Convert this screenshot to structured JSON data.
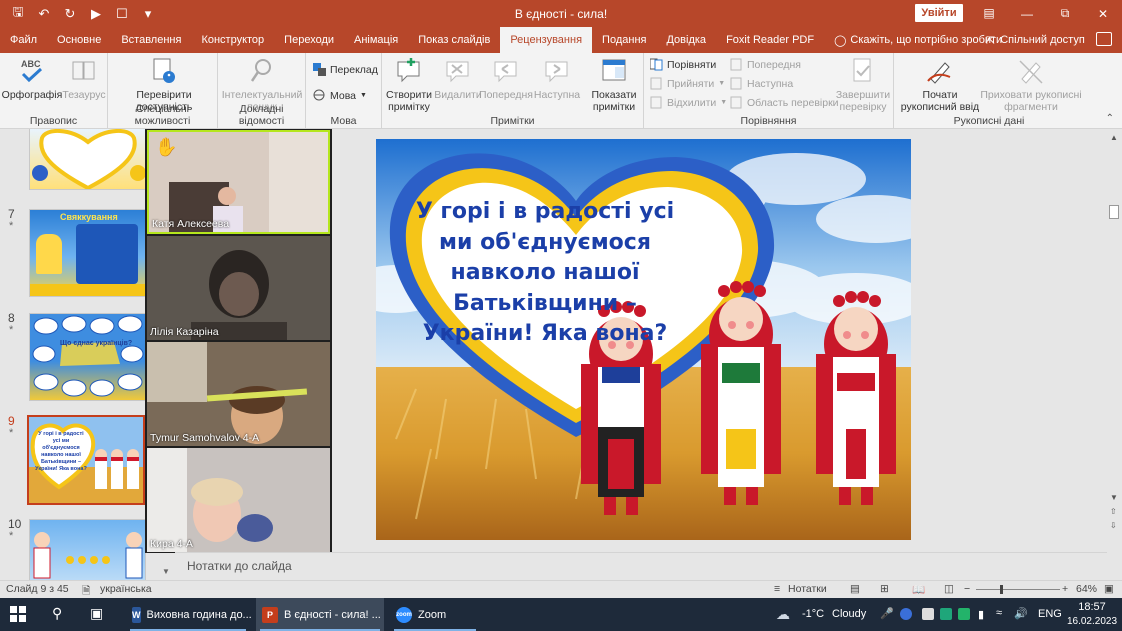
{
  "window": {
    "title": "В єдності - сила!",
    "signin_label": "Увійти"
  },
  "tabs": [
    "Файл",
    "Основне",
    "Вставлення",
    "Конструктор",
    "Переходи",
    "Анімація",
    "Показ слайдів",
    "Рецензування",
    "Подання",
    "Довідка",
    "Foxit Reader PDF"
  ],
  "tell_me": "Скажіть, що потрібно зробити",
  "share_label": "Спільний доступ",
  "ribbon": {
    "spelling": {
      "spell": "Орфографія",
      "thesaurus": "Тезаурус",
      "label": "Правопис"
    },
    "access": {
      "check": "Перевірити\nдоступність",
      "label": "Спеціальні можливості"
    },
    "insights": {
      "smart": "Інтелектуальний\nпошук",
      "label": "Докладні відомості"
    },
    "language": {
      "translate": "Переклад",
      "lang": "Мова",
      "label": "Мова"
    },
    "comments": {
      "new": "Створити\nпримітку",
      "delete": "Видалити",
      "prev": "Попередня",
      "next": "Наступна",
      "show": "Показати\nпримітки",
      "label": "Примітки"
    },
    "compare": {
      "compare": "Порівняти",
      "accept": "Прийняти",
      "reject": "Відхилити",
      "prev": "Попередня",
      "next": "Наступна",
      "pane": "Область перевірки",
      "end": "Завершити\nперевірку",
      "label": "Порівняння"
    },
    "ink": {
      "start": "Почати\nрукописний ввід",
      "hide": "Приховати рукописні\nфрагменти",
      "label": "Рукописні дані"
    }
  },
  "thumbnails": [
    {
      "num": "",
      "star": ""
    },
    {
      "num": "7",
      "star": "*",
      "title": "Свяккування"
    },
    {
      "num": "8",
      "star": "*",
      "title": "Що єднає українців?"
    },
    {
      "num": "9",
      "star": "*",
      "title": "У горі і в радості усі ми об'єднуємося навколо нашої Батьківщини – України! Яка вона?"
    },
    {
      "num": "10",
      "star": "*"
    }
  ],
  "zoom": {
    "participants": [
      "Катя Алексеева",
      "Лілія Казаріна",
      "Tymur Samohvalov 4-A",
      "Кира 4-А"
    ]
  },
  "slide": {
    "text": "У горі і в радості усі ми об'єднуємося навколо нашої Батьківщини – України! Яка вона?"
  },
  "notes_placeholder": "Нотатки до слайда",
  "status": {
    "slide": "Слайд 9 з 45",
    "language": "українська",
    "notes": "Нотатки",
    "zoom": "64%"
  },
  "taskbar": {
    "items": [
      {
        "label": "Виховна година до..."
      },
      {
        "label": "В єдності - сила! ..."
      },
      {
        "label": "Zoom"
      }
    ],
    "weather_temp": "-1°C",
    "weather_text": "Cloudy",
    "lang": "ENG",
    "time": "18:57",
    "date": "16.02.2023"
  },
  "colors": {
    "accent": "#b7472a",
    "slide_text": "#1b3fa8",
    "heart_yellow": "#f5c518",
    "heart_blue": "#2c5fc7"
  }
}
